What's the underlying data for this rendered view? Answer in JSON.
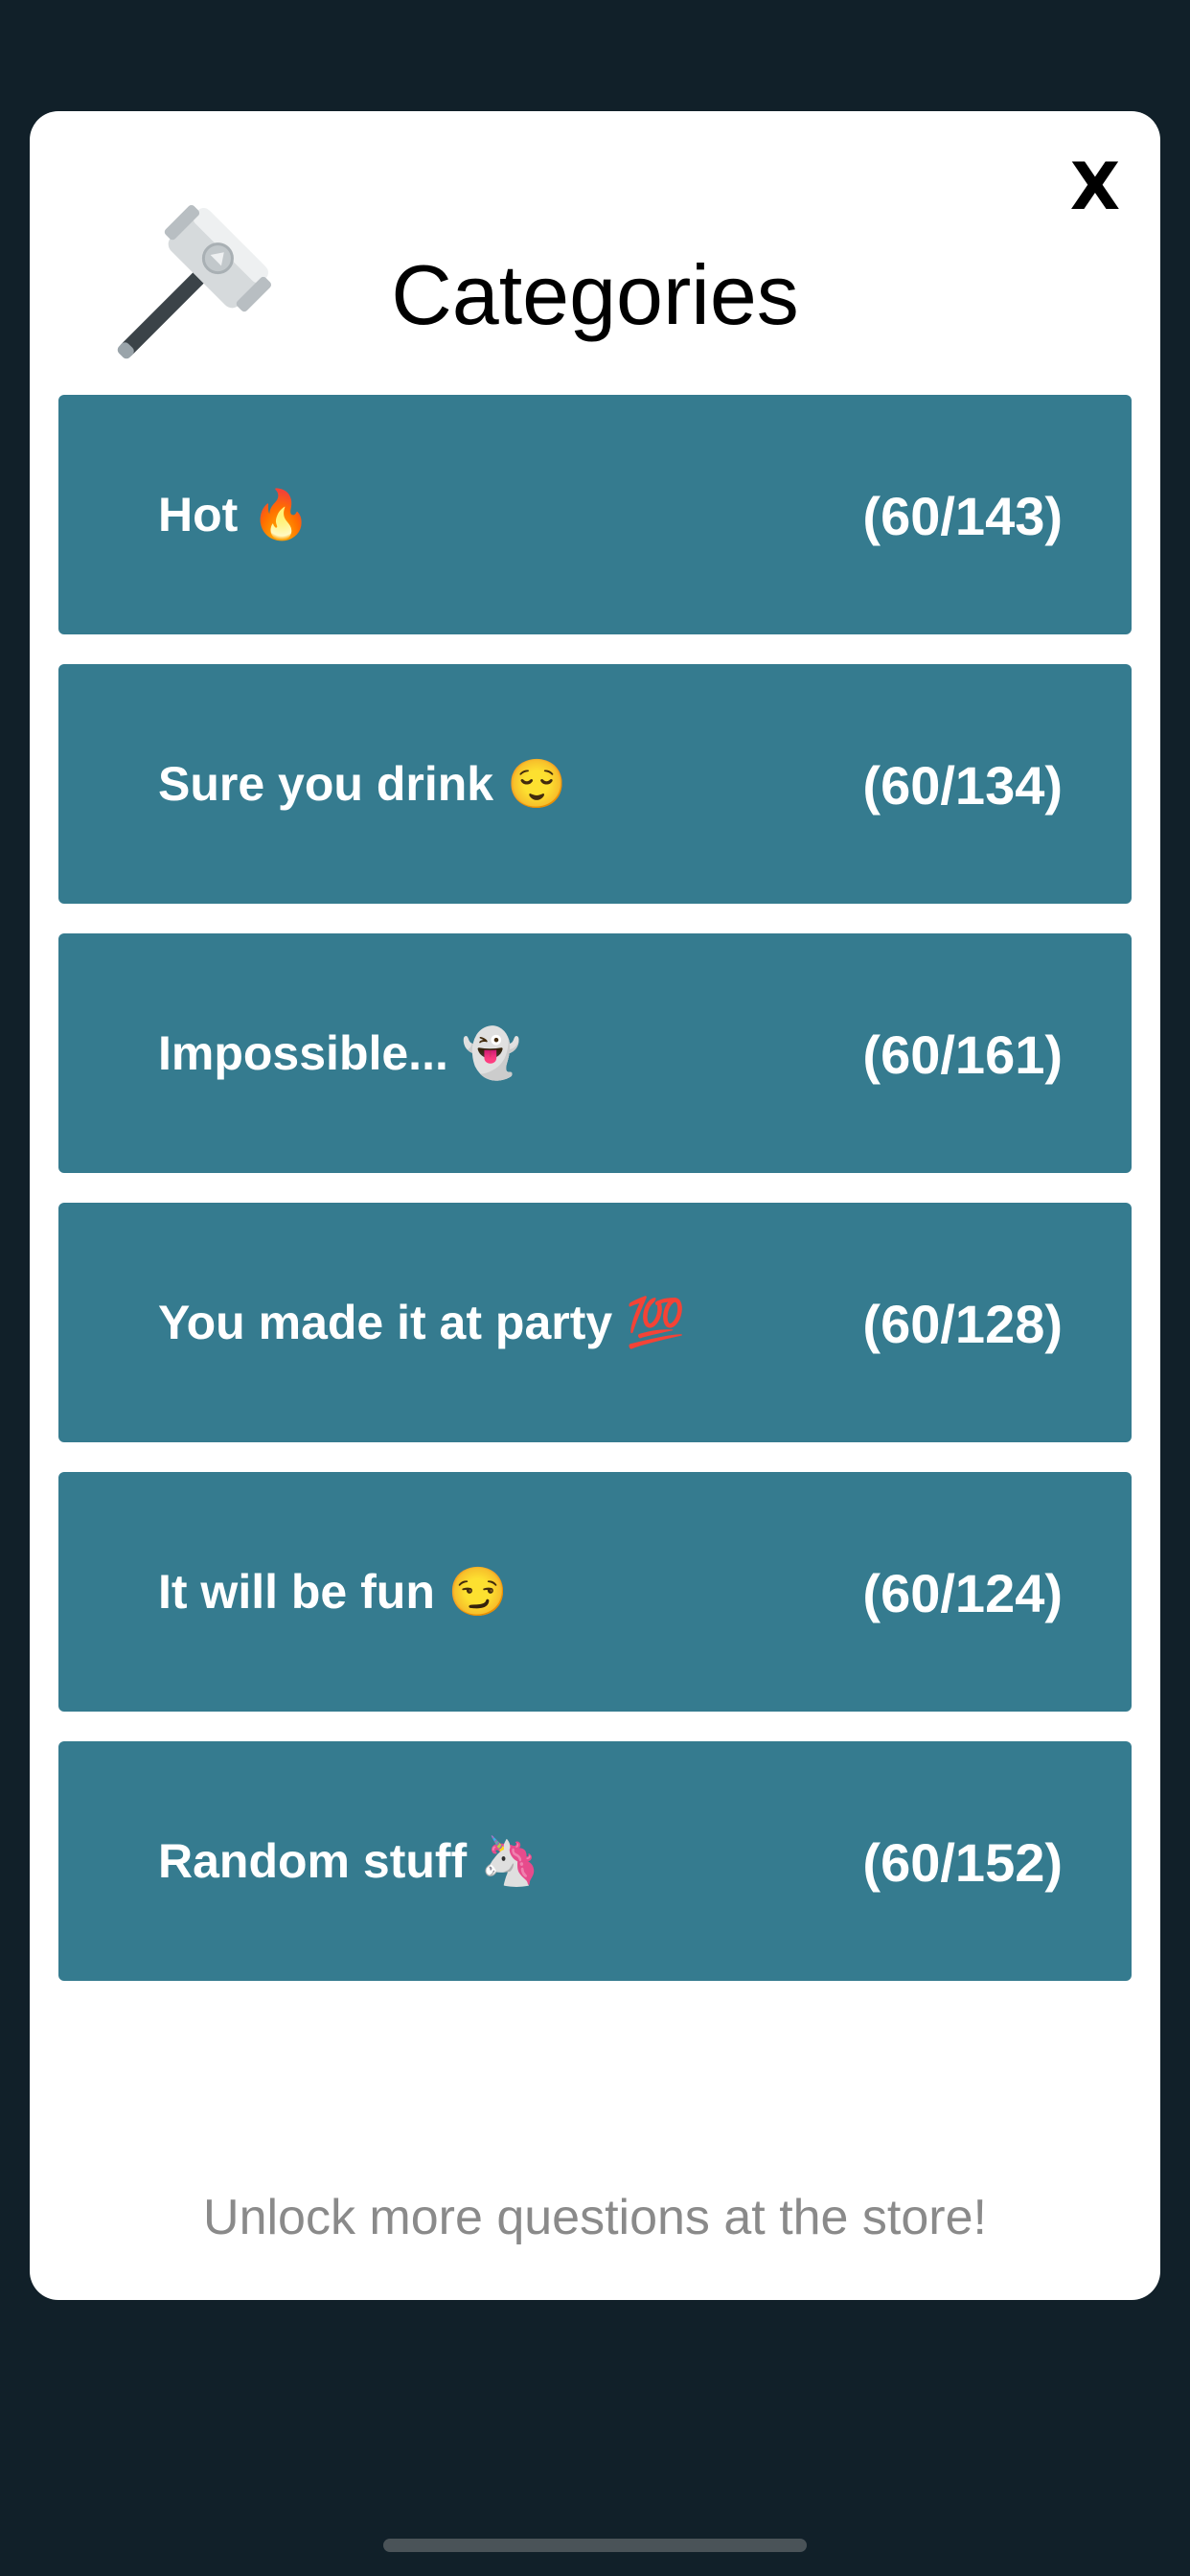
{
  "modal": {
    "title": "Categories",
    "close_label": "X",
    "header_icon": "hammer-icon"
  },
  "categories": [
    {
      "label": "Hot 🔥",
      "count": "(60/143)"
    },
    {
      "label": "Sure you drink 😌",
      "count": "(60/134)"
    },
    {
      "label": "Impossible... 👻",
      "count": "(60/161)"
    },
    {
      "label": "You made it at party 💯",
      "count": "(60/128)"
    },
    {
      "label": "It will be fun 😏",
      "count": "(60/124)"
    },
    {
      "label": "Random stuff 🦄",
      "count": "(60/152)"
    }
  ],
  "footer": {
    "store_note": "Unlock more questions at the store!"
  },
  "colors": {
    "background": "#112029",
    "modal": "#ffffff",
    "category_row": "#357b8f",
    "note_text": "#8a8a8a"
  }
}
